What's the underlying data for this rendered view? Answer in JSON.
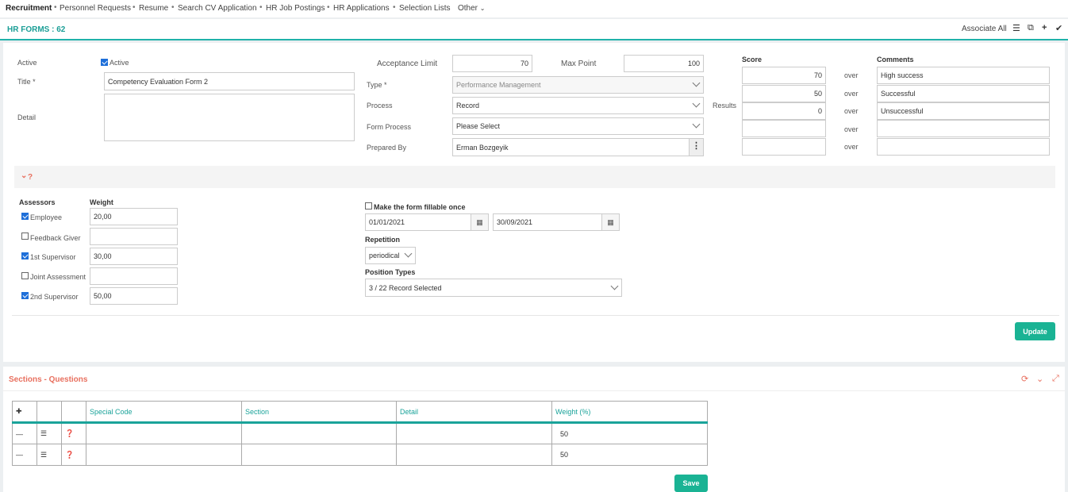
{
  "nav": {
    "items": [
      "Recruitment",
      "Personnel Requests",
      "Resume",
      "Search CV Application",
      "HR Job Postings",
      "HR Applications",
      "Selection Lists",
      "Other"
    ]
  },
  "header": {
    "title": "HR FORMS : 62",
    "associate_all": "Associate All"
  },
  "form": {
    "active_label": "Active",
    "active_checkbox_label": "Active",
    "title_label": "Title *",
    "title_value": "Competency Evaluation Form 2",
    "detail_label": "Detail",
    "acceptance_limit_label": "Acceptance Limit",
    "acceptance_limit_value": "70",
    "max_point_label": "Max Point",
    "max_point_value": "100",
    "type_label": "Type *",
    "type_value": "Performance Management",
    "process_label": "Process",
    "process_value": "Record",
    "form_process_label": "Form Process",
    "form_process_value": "Please Select",
    "prepared_by_label": "Prepared By",
    "prepared_by_value": "Erman Bozgeyik",
    "results_label": "Results",
    "score_header": "Score",
    "comments_header": "Comments",
    "over_label": "over",
    "results": [
      {
        "score": "70",
        "comment": "High success"
      },
      {
        "score": "50",
        "comment": "Successful"
      },
      {
        "score": "0",
        "comment": "Unsuccessful"
      },
      {
        "score": "",
        "comment": ""
      },
      {
        "score": "",
        "comment": ""
      }
    ],
    "collapse_label": "?"
  },
  "assessors": {
    "header": "Assessors",
    "weight_header": "Weight",
    "rows": [
      {
        "label": "Employee",
        "checked": true,
        "weight": "20,00"
      },
      {
        "label": "Feedback Giver",
        "checked": false,
        "weight": ""
      },
      {
        "label": "1st Supervisor",
        "checked": true,
        "weight": "30,00"
      },
      {
        "label": "Joint Assessment",
        "checked": false,
        "weight": ""
      },
      {
        "label": "2nd Supervisor",
        "checked": true,
        "weight": "50,00"
      }
    ]
  },
  "fillable": {
    "label": "Make the form fillable once",
    "start_date": "01/01/2021",
    "end_date": "30/09/2021",
    "repetition_label": "Repetition",
    "repetition_value": "periodical",
    "position_types_label": "Position Types",
    "position_types_value": "3 / 22 Record Selected"
  },
  "update_button": "Update",
  "sections": {
    "title": "Sections - Questions",
    "columns": [
      "Special Code",
      "Section",
      "Detail",
      "Weight (%)"
    ],
    "rows": [
      {
        "special_code": "",
        "section": "",
        "detail": "",
        "weight": "50"
      },
      {
        "special_code": "",
        "section": "",
        "detail": "",
        "weight": "50"
      }
    ],
    "save_button": "Save"
  },
  "colors": {
    "accent": "#1ab394",
    "title_teal": "#1a9e96",
    "section_red": "#e8705f"
  }
}
